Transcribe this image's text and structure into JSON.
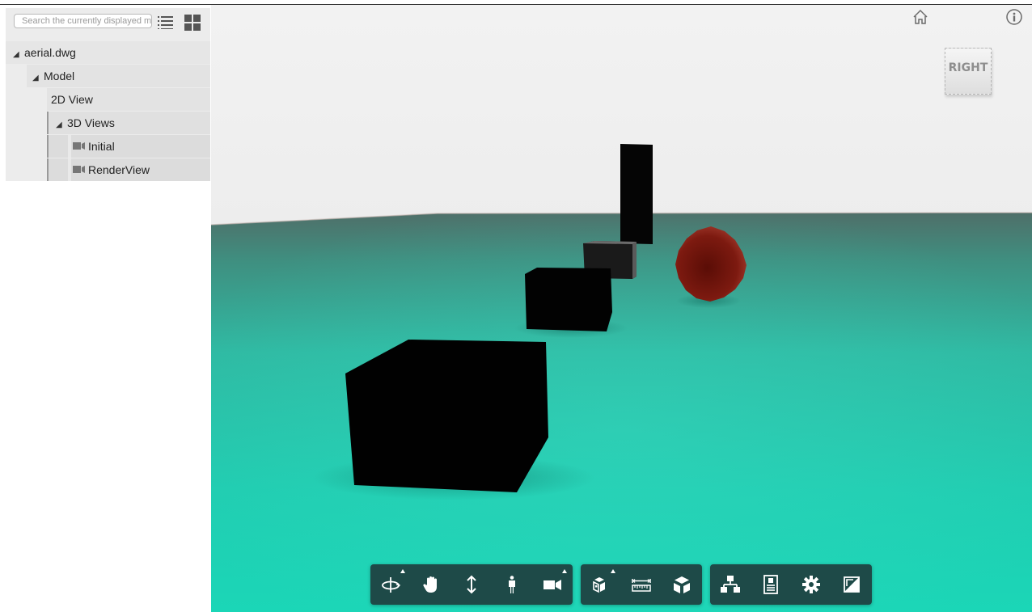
{
  "browser": {
    "search_placeholder": "Search the currently displayed model",
    "tree": {
      "root": "aerial.dwg",
      "model": "Model",
      "view2d": "2D View",
      "views3d": "3D Views",
      "initial": "Initial",
      "renderview": "RenderView"
    }
  },
  "viewcube": {
    "label": "RIGHT"
  },
  "toolbar": {
    "navigation": [
      "orbit-icon",
      "pan-icon",
      "dolly-icon",
      "first-person-icon",
      "camera-icon"
    ],
    "modeling": [
      "explode-icon",
      "measure-icon",
      "section-icon"
    ],
    "settings": [
      "model-browser-icon",
      "properties-icon",
      "settings-icon",
      "fullscreen-icon"
    ]
  },
  "colors": {
    "toolbar_bg": "#1e4a48",
    "ground": "#1dd3b5",
    "sky": "#f0f0f0",
    "sphere": "#7a1a10"
  }
}
